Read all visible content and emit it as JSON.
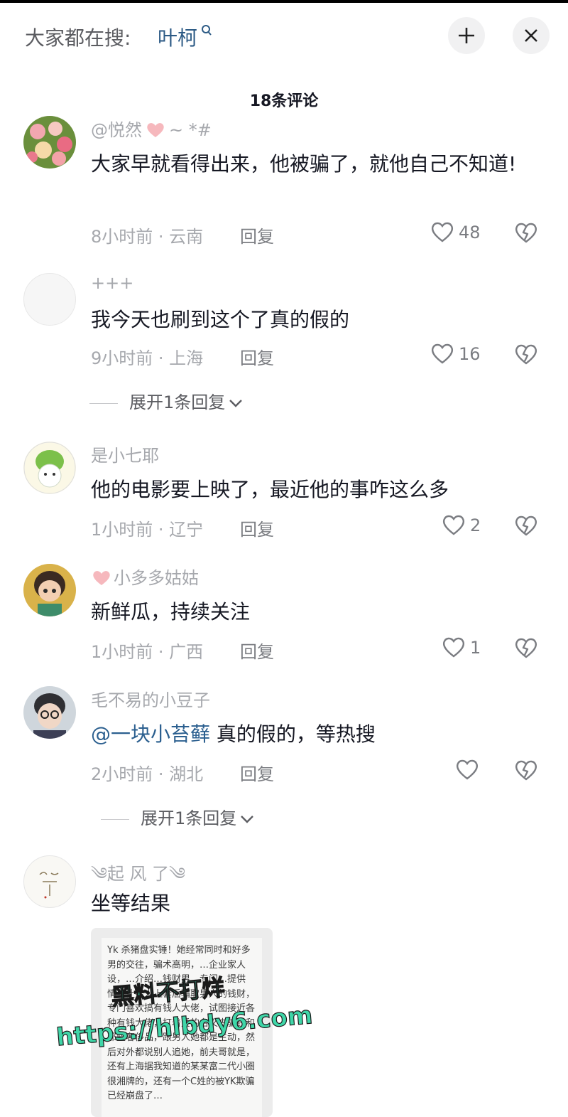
{
  "topbar": {
    "search_prefix": "大家都在搜:",
    "search_term": "叶柯",
    "collapse_icon": "collapse-icon",
    "close_icon": "close-icon"
  },
  "comment_count": "18条评论",
  "comments": [
    {
      "username": "@悦然",
      "username_suffix": "~ *#",
      "text": "大家早就看得出来，他被骗了，就他自己不知道!",
      "time": "8小时前",
      "location": "云南",
      "reply_label": "回复",
      "likes": "48"
    },
    {
      "username": "+++",
      "text": "我今天也刷到这个了真的假的",
      "time": "9小时前",
      "location": "上海",
      "reply_label": "回复",
      "likes": "16",
      "expand_label": "展开1条回复"
    },
    {
      "username": "是小七耶",
      "text": "他的电影要上映了，最近他的事咋这么多",
      "time": "1小时前",
      "location": "辽宁",
      "reply_label": "回复",
      "likes": "2"
    },
    {
      "username": "小多多姑姑",
      "text": "新鲜瓜，持续关注",
      "time": "1小时前",
      "location": "广西",
      "reply_label": "回复",
      "likes": "1"
    },
    {
      "username": "毛不易的小豆子",
      "mention": "@一块小苔藓",
      "text": "真的假的，等热搜",
      "time": "2小时前",
      "location": "湖北",
      "reply_label": "回复",
      "likes": "",
      "expand_label": "展开1条回复"
    },
    {
      "username": "༄起 风 了༄",
      "text": "坐等结果",
      "image_text": "Yk 杀猪盘实锤！她经常同时和好多男的交往，骗术高明，…企业家人设，…介绍…钱财男…专门…提供情…让男人上套后骗取男人的钱财，专门喜欢搞有钱人大佬，试图接近各种有钱大佬，打着爱的名义去骗钱和那些奢侈品，跟男人她都是主动，然后对外都说别人追她，前夫哥就是，还有上海据我知道的某某富二代小圈很湘牌的，还有一个C姓的被YK欺骗已经崩盘了…"
    }
  ],
  "watermark": {
    "line1": "黑料不打烊",
    "line2": "https://hlbdy6.com"
  },
  "colors": {
    "text_primary": "#161823",
    "text_secondary": "#a6a8ad",
    "mention": "#2b5f8f",
    "search_term": "#2c5a85",
    "watermark_fill": "#3fd6a8"
  }
}
